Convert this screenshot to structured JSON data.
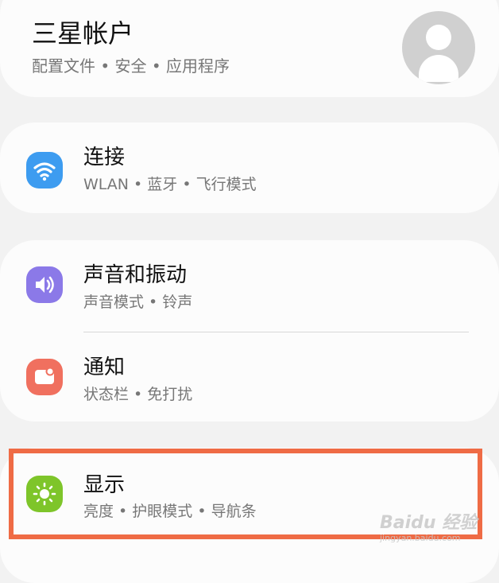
{
  "account": {
    "title": "三星帐户",
    "subtitle": "配置文件 • 安全 • 应用程序",
    "avatar_icon": "person-avatar-icon"
  },
  "settings": [
    {
      "title": "连接",
      "subtitle": "WLAN • 蓝牙 • 飞行模式",
      "icon": "wifi-icon",
      "icon_color": "#3d9cf0"
    },
    {
      "title": "声音和振动",
      "subtitle": "声音模式 • 铃声",
      "icon": "volume-icon",
      "icon_color": "#8b79e8"
    },
    {
      "title": "通知",
      "subtitle": "状态栏 • 免打扰",
      "icon": "notification-icon",
      "icon_color": "#f0705f"
    },
    {
      "title": "显示",
      "subtitle": "亮度 • 护眼模式 • 导航条",
      "icon": "brightness-icon",
      "icon_color": "#7ec52a"
    }
  ],
  "highlight": {
    "color": "#ef6b45"
  },
  "watermark": {
    "logo": "Baidu 经验",
    "url": "jingyan.baidu.com"
  }
}
